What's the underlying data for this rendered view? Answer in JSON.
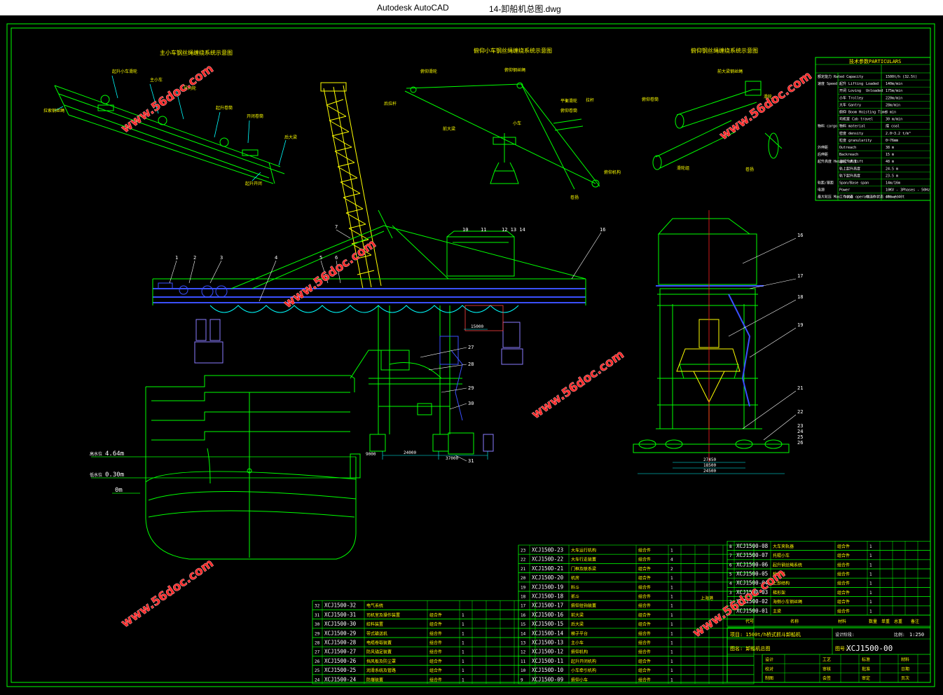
{
  "window": {
    "app_title": "Autodesk AutoCAD",
    "file_title": "14-卸船机总图.dwg"
  },
  "colors": {
    "background": "#000000",
    "frame": "#00ff00",
    "structure": "#00ff00",
    "boom": "#ffff00",
    "trolley": "#3a50ff",
    "ship": "#00ff00",
    "dimension": "#00ffff",
    "bogie": "#8a7cff",
    "watermark": "#ff2a2a"
  },
  "watermark": "www.56doc.com",
  "views": {
    "trolley_diagram_title": "主小车钢丝绳缠绕系统示意图",
    "luffing_diagram_title": "俯仰小车钢丝绳缠绕系统示意图",
    "boom_diagram_title": "俯仰钢丝绳缠绕系统示意图"
  },
  "water_levels": [
    {
      "label": "高水位",
      "value": "4.64m"
    },
    {
      "label": "低水位",
      "value": "0.30m"
    },
    {
      "label": "",
      "value": "0m"
    }
  ],
  "elevation_balloons": [
    "1",
    "2",
    "3",
    "4",
    "5",
    "6",
    "7",
    "10",
    "11",
    "12",
    "13",
    "14",
    "16"
  ],
  "section_balloons": [
    "16",
    "17",
    "18",
    "19",
    "21",
    "22",
    "23",
    "24",
    "25",
    "26"
  ],
  "lower_balloons": [
    "27",
    "28",
    "29",
    "30",
    "31"
  ],
  "dimensions": {
    "beam_span": "15000",
    "rail_left": "9000",
    "rail_main": "24000",
    "rail_right": "37000",
    "side_a": "27450",
    "side_b": "18500",
    "side_c": "24500"
  },
  "particulars": {
    "title": "技术参数PARTICULARS",
    "rows": [
      {
        "group": "额定能力 Rated Capacity",
        "item": "",
        "value": "1500t/h (32.5t)"
      },
      {
        "group": "速度 Speed",
        "item": "起升 Lifting",
        "sub": "Loaded",
        "value": "140m/min"
      },
      {
        "group": "",
        "item": "开闭 Loving",
        "sub": "Unloaded",
        "value": "175m/min"
      },
      {
        "group": "",
        "item": "小车 Trolley",
        "sub": "",
        "value": "220m/min"
      },
      {
        "group": "",
        "item": "大车 Gantry",
        "sub": "",
        "value": "28m/min"
      },
      {
        "group": "",
        "item": "俯仰 Boom Hoisting Time",
        "sub": "",
        "value": "8 min"
      },
      {
        "group": "",
        "item": "司机室 Cab travel",
        "sub": "",
        "value": "30 m/min"
      },
      {
        "group": "物料 cargo",
        "item": "物料 material",
        "sub": "",
        "value": "煤 coal"
      },
      {
        "group": "",
        "item": "密度 density",
        "sub": "",
        "value": "2.0~3.2 t/m³"
      },
      {
        "group": "",
        "item": "粒度 granularity",
        "sub": "",
        "value": "0~76mm"
      },
      {
        "group": "外伸距",
        "item": "Outreach",
        "sub": "",
        "value": "38 m"
      },
      {
        "group": "后伸距",
        "item": "Backreach",
        "sub": "",
        "value": "15 m"
      },
      {
        "group": "起升高度 Height of lift",
        "item": "总起升高度",
        "sub": "",
        "value": "48 m"
      },
      {
        "group": "",
        "item": "轨上起升高度",
        "sub": "",
        "value": "24.5 m"
      },
      {
        "group": "",
        "item": "轨下起升高度",
        "sub": "",
        "value": "23.5 m"
      },
      {
        "group": "轨距/基距",
        "item": "Span/Base span",
        "sub": "",
        "value": "14m/16m"
      },
      {
        "group": "电源",
        "item": "Power",
        "sub": "",
        "value": "10KV - 3Phases - 50Hz"
      },
      {
        "group": "最大轮压 Max. load",
        "item": "工作状态 operation",
        "sub": "非工作状态 stowed",
        "value": "40t / 40t"
      }
    ]
  },
  "parts_list_left": [
    {
      "no": "32",
      "code": "XCJ1500-32",
      "name": "电气系统",
      "type": "",
      "qty": ""
    },
    {
      "no": "31",
      "code": "XCJ1500-31",
      "name": "司机室及操作装置",
      "type": "组合件",
      "qty": "1"
    },
    {
      "no": "30",
      "code": "XCJ1500-30",
      "name": "给料装置",
      "type": "组合件",
      "qty": "1"
    },
    {
      "no": "29",
      "code": "XCJ1500-29",
      "name": "带式输送机",
      "type": "组合件",
      "qty": "1"
    },
    {
      "no": "28",
      "code": "XCJ1500-28",
      "name": "电缆卷取装置",
      "type": "组合件",
      "qty": "1"
    },
    {
      "no": "27",
      "code": "XCJ1500-27",
      "name": "防风锚定装置",
      "type": "组合件",
      "qty": "1"
    },
    {
      "no": "26",
      "code": "XCJ1500-26",
      "name": "挡风板及防尘罩",
      "type": "组合件",
      "qty": "1"
    },
    {
      "no": "25",
      "code": "XCJ1500-25",
      "name": "润滑系统及管路",
      "type": "组合件",
      "qty": "1"
    },
    {
      "no": "24",
      "code": "XCJ1500-24",
      "name": "防爆装置",
      "type": "组合件",
      "qty": "1"
    }
  ],
  "parts_list_mid": [
    {
      "no": "23",
      "code": "XCJ150D-23",
      "name": "大车运行机构",
      "type": "组合件",
      "qty": "1"
    },
    {
      "no": "22",
      "code": "XCJ150D-22",
      "name": "大车行走装置",
      "type": "组合件",
      "qty": "4"
    },
    {
      "no": "21",
      "code": "XCJ150D-21",
      "name": "门框及联系梁",
      "type": "组合件",
      "qty": "2"
    },
    {
      "no": "20",
      "code": "XCJ150D-20",
      "name": "机房",
      "type": "组合件",
      "qty": "1"
    },
    {
      "no": "19",
      "code": "XCJ150D-19",
      "name": "料斗",
      "type": "组合件",
      "qty": "1"
    },
    {
      "no": "18",
      "code": "XCJ150D-18",
      "name": "抓斗",
      "type": "组合件",
      "qty": "1"
    },
    {
      "no": "17",
      "code": "XCJ150D-17",
      "name": "俯仰挂钩装置",
      "type": "组合件",
      "qty": "1"
    },
    {
      "no": "16",
      "code": "XCJ150D-16",
      "name": "前大梁",
      "type": "组合件",
      "qty": "1"
    },
    {
      "no": "15",
      "code": "XCJ150D-15",
      "name": "后大梁",
      "type": "组合件",
      "qty": "1"
    },
    {
      "no": "14",
      "code": "XCJ150D-14",
      "name": "梯子平台",
      "type": "组合件",
      "qty": "1"
    },
    {
      "no": "13",
      "code": "XCJ150D-13",
      "name": "主小车",
      "type": "组合件",
      "qty": "1"
    },
    {
      "no": "12",
      "code": "XCJ150D-12",
      "name": "俯仰机构",
      "type": "组合件",
      "qty": "1"
    },
    {
      "no": "11",
      "code": "XCJ150D-11",
      "name": "起升开闭机构",
      "type": "组合件",
      "qty": "1"
    },
    {
      "no": "10",
      "code": "XCJ150D-10",
      "name": "小车牵引机构",
      "type": "组合件",
      "qty": "1"
    },
    {
      "no": "9",
      "code": "XCJ150D-09",
      "name": "俯仰小车",
      "type": "组合件",
      "qty": "1"
    }
  ],
  "parts_list_right": [
    {
      "no": "8",
      "code": "XCJ1500-08",
      "name": "大车夹轨器",
      "type": "组合件",
      "qty": "1"
    },
    {
      "no": "7",
      "code": "XCJ1500-07",
      "name": "托辊小车",
      "type": "组合件",
      "qty": "1"
    },
    {
      "no": "6",
      "code": "XCJ1500-06",
      "name": "起升钢丝绳系统",
      "type": "组合件",
      "qty": "1"
    },
    {
      "no": "5",
      "code": "XCJ1500-05",
      "name": "检修吊",
      "type": "组合件",
      "qty": "1"
    },
    {
      "no": "4",
      "code": "XCJ1500-04",
      "name": "上部结构",
      "type": "组合件",
      "qty": "1"
    },
    {
      "no": "3",
      "code": "XCJ1500-03",
      "name": "梯形架",
      "type": "组合件",
      "qty": "1"
    },
    {
      "no": "2",
      "code": "XCJ1500-02",
      "name": "海侧小车钢丝绳",
      "type": "组合件",
      "qty": "1"
    },
    {
      "no": "1",
      "code": "XCJ1500-01",
      "name": "主梁",
      "type": "组合件",
      "qty": "1"
    }
  ],
  "parts_header": {
    "no": "序号",
    "code": "代号",
    "name": "名称",
    "type": "材料",
    "qty": "数量",
    "wt": "单重",
    "total": "总重",
    "remark": "备注"
  },
  "title_block": {
    "project": "项目: 1500t/h桥式抓斗卸船机",
    "stage": "设计阶段:",
    "scale_label": "比例:",
    "scale": "1:250",
    "drawing_name": "图名: 卸船机总图",
    "drawing_no_label": "图号:",
    "drawing_no": "XCJ1500-00",
    "sign_rows": [
      [
        "设计",
        "",
        "工艺",
        "",
        "标准",
        "",
        "材料"
      ],
      [
        "校对",
        "",
        "审核",
        "",
        "批准",
        "",
        "日期"
      ],
      [
        "制图",
        "",
        "会签",
        "",
        "审定",
        "",
        "页次"
      ]
    ]
  },
  "table_note": "上海港",
  "status_note": ""
}
